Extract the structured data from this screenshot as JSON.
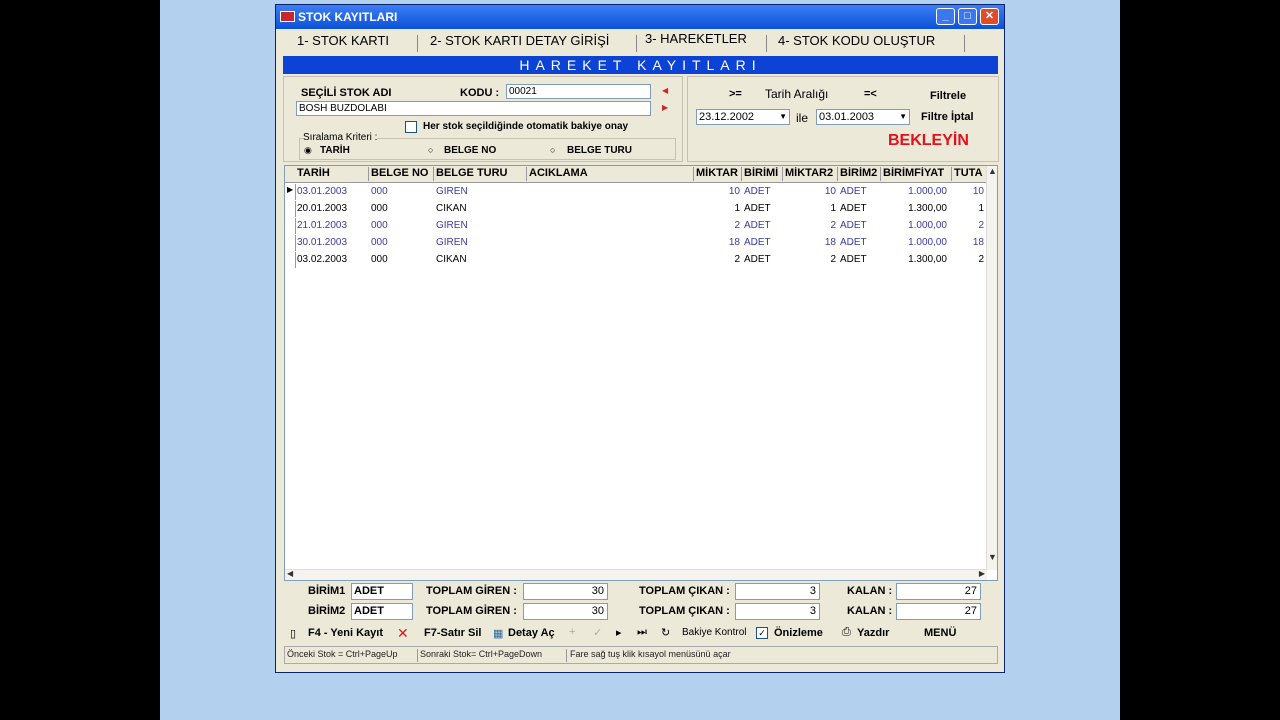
{
  "window": {
    "title": "STOK KAYITLARI"
  },
  "tabs": [
    {
      "label": "1- STOK KARTI"
    },
    {
      "label": "2- STOK KARTI DETAY GİRİŞİ"
    },
    {
      "label": "3- HAREKETLER"
    },
    {
      "label": "4- STOK KODU OLUŞTUR"
    }
  ],
  "banner": "HAREKET KAYITLARI",
  "stock": {
    "name_label": "SEÇİLİ STOK ADI",
    "code_label": "KODU :",
    "code_value": "00021",
    "name_value": "BOSH BUZDOLABI",
    "auto_balance_label": "Her stok seçildiğinde otomatik bakiye onay",
    "sort_label": "Sıralama Kriteri :",
    "sort_options": [
      "TARİH",
      "BELGE NO",
      "BELGE TURU"
    ],
    "sort_selected": "TARİH"
  },
  "filter": {
    "gte": ">=",
    "range_label": "Tarih Aralığı",
    "lte": "=<",
    "from": "23.12.2002",
    "between": "ile",
    "to": "03.01.2003",
    "filter_button": "Filtrele",
    "cancel_button": "Filtre İptal",
    "status": "BEKLEYİN"
  },
  "grid": {
    "columns": [
      "TARİH",
      "BELGE NO",
      "BELGE TURU",
      "ACIKLAMA",
      "MİKTAR",
      "BİRİMİ",
      "MİKTAR2",
      "BİRİM2",
      "BİRİMFİYAT",
      "TUTA"
    ],
    "rows": [
      {
        "tarih": "03.01.2003",
        "belge_no": "000",
        "belge_turu": "GİREN",
        "aciklama": "",
        "miktar": "10",
        "birim": "ADET",
        "miktar2": "10",
        "birim2": "ADET",
        "fiyat": "1.000,00",
        "tutar": "10"
      },
      {
        "tarih": "20.01.2003",
        "belge_no": "000",
        "belge_turu": "CIKAN",
        "aciklama": "",
        "miktar": "1",
        "birim": "ADET",
        "miktar2": "1",
        "birim2": "ADET",
        "fiyat": "1.300,00",
        "tutar": "1"
      },
      {
        "tarih": "21.01.2003",
        "belge_no": "000",
        "belge_turu": "GİREN",
        "aciklama": "",
        "miktar": "2",
        "birim": "ADET",
        "miktar2": "2",
        "birim2": "ADET",
        "fiyat": "1.000,00",
        "tutar": "2"
      },
      {
        "tarih": "30.01.2003",
        "belge_no": "000",
        "belge_turu": "GİREN",
        "aciklama": "",
        "miktar": "18",
        "birim": "ADET",
        "miktar2": "18",
        "birim2": "ADET",
        "fiyat": "1.000,00",
        "tutar": "18"
      },
      {
        "tarih": "03.02.2003",
        "belge_no": "000",
        "belge_turu": "CIKAN",
        "aciklama": "",
        "miktar": "2",
        "birim": "ADET",
        "miktar2": "2",
        "birim2": "ADET",
        "fiyat": "1.300,00",
        "tutar": "2"
      }
    ]
  },
  "totals": [
    {
      "birim_label": "BİRİM1",
      "birim": "ADET",
      "giren_label": "TOPLAM GİREN :",
      "giren": "30",
      "cikan_label": "TOPLAM ÇIKAN :",
      "cikan": "3",
      "kalan_label": "KALAN :",
      "kalan": "27"
    },
    {
      "birim_label": "BİRİM2",
      "birim": "ADET",
      "giren_label": "TOPLAM GİREN :",
      "giren": "30",
      "cikan_label": "TOPLAM ÇIKAN :",
      "cikan": "3",
      "kalan_label": "KALAN :",
      "kalan": "27"
    }
  ],
  "toolbar": {
    "new": "F4 - Yeni Kayıt",
    "delete": "F7-Satır Sil",
    "detail": "Detay Aç",
    "balance": "Bakiye Kontrol",
    "preview": "Önizleme",
    "print": "Yazdır",
    "menu": "MENÜ"
  },
  "statusbar": [
    "Önceki Stok = Ctrl+PageUp",
    "Sonraki Stok= Ctrl+PageDown",
    "Fare sağ tuş klik kısayol menüsünü açar"
  ],
  "colors": {
    "titlebar": "#0a52d6",
    "banner": "#0c43d5",
    "status_red": "#e0121b",
    "giren_blue": "#3a3aa8"
  }
}
